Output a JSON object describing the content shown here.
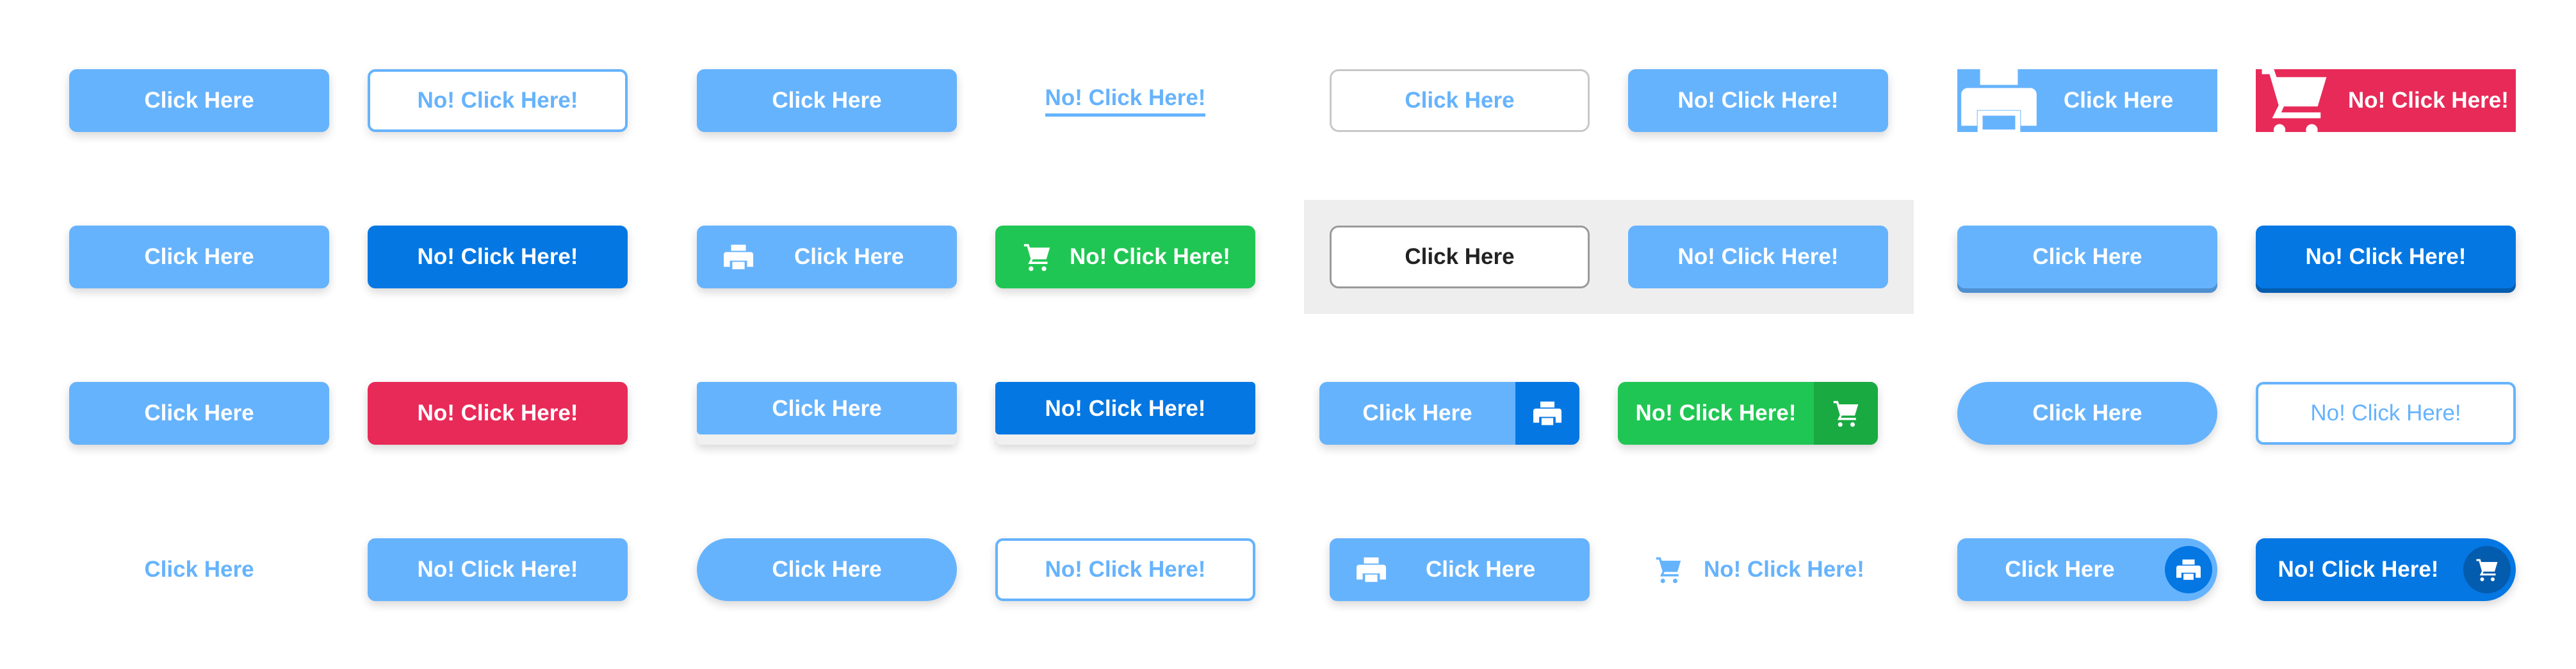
{
  "buttons": {
    "click_here": "Click Here",
    "no_click_here": "No! Click Here!"
  },
  "icons": {
    "printer": "printer-icon",
    "cart": "shopping-cart-icon"
  },
  "colors": {
    "light_blue": "#66b3fd",
    "dark_blue": "#0477e3",
    "green": "#20c653",
    "dark_green": "#1aaa42",
    "red": "#e82a58",
    "grey_panel": "#eeeeee",
    "text_dark": "#222222"
  }
}
